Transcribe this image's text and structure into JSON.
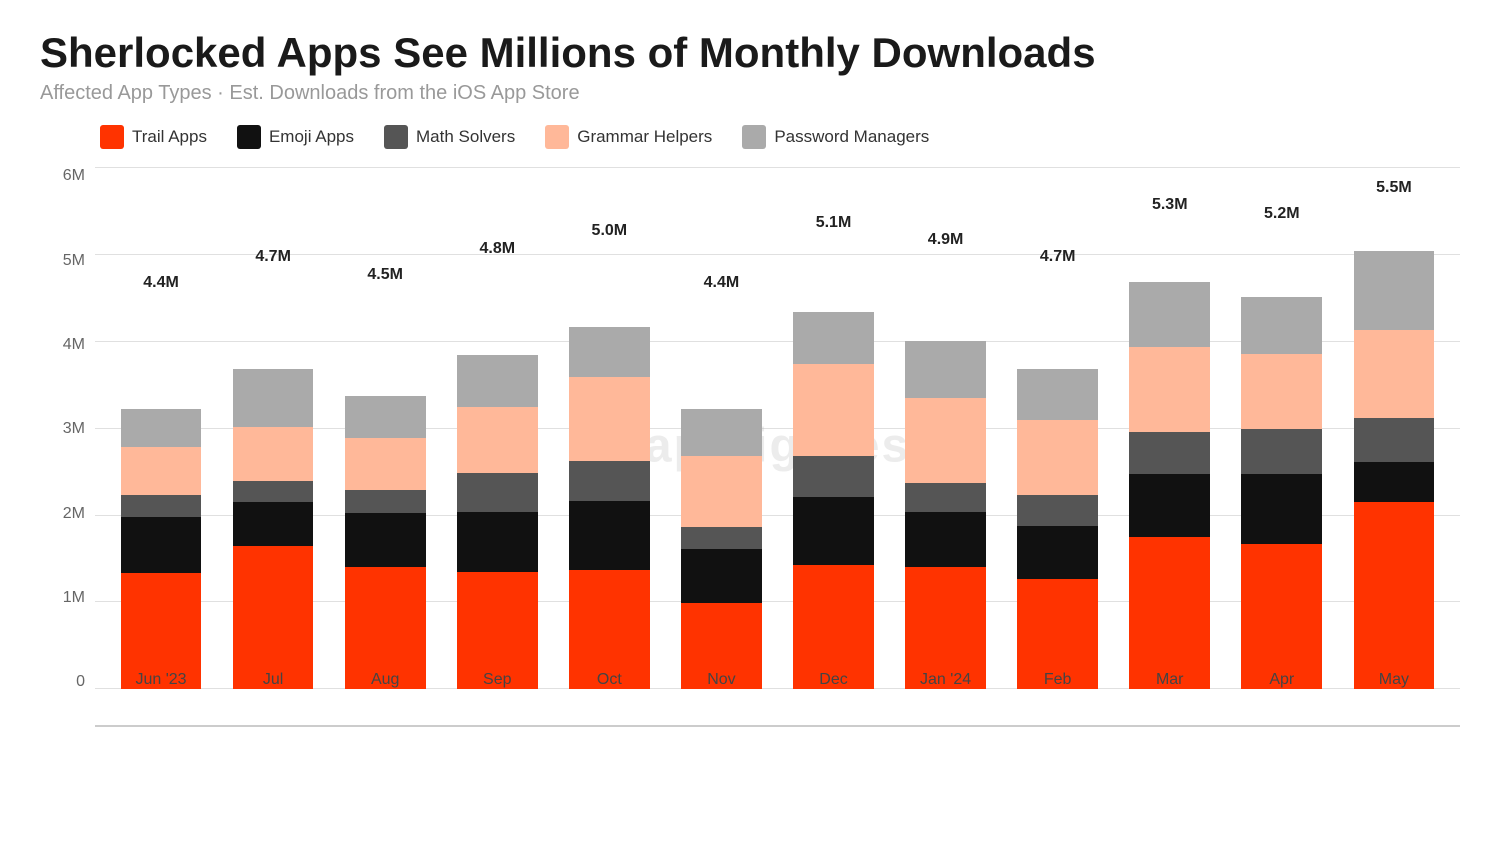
{
  "title": "Sherlocked Apps See Millions of Monthly Downloads",
  "subtitle_main": "Affected App Types",
  "subtitle_sep": " · ",
  "subtitle_sub": "Est. Downloads from the iOS App Store",
  "legend": [
    {
      "label": "Trail Apps",
      "color": "#ff3300"
    },
    {
      "label": "Emoji Apps",
      "color": "#111111"
    },
    {
      "label": "Math Solvers",
      "color": "#555555"
    },
    {
      "label": "Grammar Helpers",
      "color": "#ffb899"
    },
    {
      "label": "Password Managers",
      "color": "#aaaaaa"
    }
  ],
  "yAxis": [
    "0",
    "1M",
    "2M",
    "3M",
    "4M",
    "5M",
    "6M"
  ],
  "maxValue": 6,
  "bars": [
    {
      "month": "Jun '23",
      "total": "4.4M",
      "trail": 1.82,
      "emoji": 0.88,
      "math": 0.35,
      "grammar": 0.75,
      "password": 0.6
    },
    {
      "month": "Jul",
      "total": "4.7M",
      "trail": 2.1,
      "emoji": 0.65,
      "math": 0.3,
      "grammar": 0.8,
      "password": 0.85
    },
    {
      "month": "Aug",
      "total": "4.5M",
      "trail": 1.88,
      "emoji": 0.82,
      "math": 0.35,
      "grammar": 0.8,
      "password": 0.65
    },
    {
      "month": "Sep",
      "total": "4.8M",
      "trail": 1.68,
      "emoji": 0.87,
      "math": 0.55,
      "grammar": 0.95,
      "password": 0.75
    },
    {
      "month": "Oct",
      "total": "5.0M",
      "trail": 1.65,
      "emoji": 0.95,
      "math": 0.55,
      "grammar": 1.15,
      "password": 0.7
    },
    {
      "month": "Nov",
      "total": "4.4M",
      "trail": 1.35,
      "emoji": 0.85,
      "math": 0.35,
      "grammar": 1.1,
      "password": 0.75
    },
    {
      "month": "Dec",
      "total": "5.1M",
      "trail": 1.68,
      "emoji": 0.92,
      "math": 0.55,
      "grammar": 1.25,
      "password": 0.7
    },
    {
      "month": "Jan '24",
      "total": "4.9M",
      "trail": 1.72,
      "emoji": 0.78,
      "math": 0.4,
      "grammar": 1.2,
      "password": 0.8
    },
    {
      "month": "Feb",
      "total": "4.7M",
      "trail": 1.62,
      "emoji": 0.78,
      "math": 0.45,
      "grammar": 1.1,
      "password": 0.75
    },
    {
      "month": "Mar",
      "total": "5.3M",
      "trail": 1.98,
      "emoji": 0.82,
      "math": 0.55,
      "grammar": 1.1,
      "password": 0.85
    },
    {
      "month": "Apr",
      "total": "5.2M",
      "trail": 1.92,
      "emoji": 0.93,
      "math": 0.6,
      "grammar": 1.0,
      "password": 0.75
    },
    {
      "month": "May",
      "total": "5.5M",
      "trail": 2.35,
      "emoji": 0.5,
      "math": 0.55,
      "grammar": 1.1,
      "password": 1.0
    }
  ],
  "watermark": "appfigures"
}
